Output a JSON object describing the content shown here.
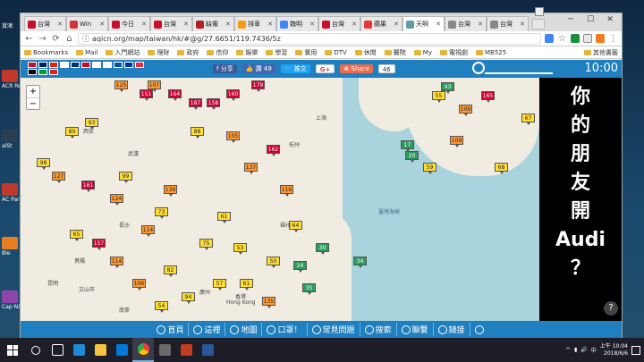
{
  "desktop": {
    "icons": [
      {
        "label": "賞鴻"
      },
      {
        "label": "ACR Read"
      },
      {
        "label": "alSt"
      },
      {
        "label": "AC Parti"
      },
      {
        "label": "Ble"
      },
      {
        "label": "Cap NX"
      }
    ]
  },
  "browser": {
    "tabs": [
      {
        "label": "台灣",
        "icon": "flag-tw-favicon",
        "color": "#c8102e"
      },
      {
        "label": "Win",
        "icon": "red-circle-favicon",
        "color": "#d13438"
      },
      {
        "label": "今日",
        "icon": "flag-favicon",
        "color": "#c8102e"
      },
      {
        "label": "台灣",
        "icon": "flag-favicon",
        "color": "#c8102e"
      },
      {
        "label": "缺電",
        "icon": "news-favicon",
        "color": "#b22222"
      },
      {
        "label": "排車",
        "icon": "orange-favicon",
        "color": "#f39c12"
      },
      {
        "label": "魏明",
        "icon": "google-favicon",
        "color": "#4285f4"
      },
      {
        "label": "台灣",
        "icon": "flag-favicon",
        "color": "#c8102e"
      },
      {
        "label": "蘋果",
        "icon": "apple-favicon",
        "color": "#e53935"
      },
      {
        "label": "天啊",
        "icon": "loading-favicon",
        "color": "#5f9ea0"
      },
      {
        "label": "台灣",
        "icon": "page-favicon",
        "color": "#888888"
      },
      {
        "label": "台灣",
        "icon": "page-favicon",
        "color": "#888888"
      }
    ],
    "url": "aqicn.org/map/taiwan/hk/#@g/27.6651/119.7436/5z",
    "bookmarks": [
      "Bookmarks",
      "Mail",
      "入門網站",
      "理財",
      "政府",
      "信仰",
      "娛樂",
      "學習",
      "實用",
      "DTV",
      "休閒",
      "醫院",
      "My",
      "電視劇",
      "MB525"
    ],
    "bookmarks_other": "其他書籤"
  },
  "site": {
    "share_label": "分享",
    "like_label": "讚",
    "like_count": "49",
    "tweet_label": "推文",
    "gplus_label": "G+",
    "sharebtn_label": "Share",
    "share_count": "46",
    "clock": "10:00",
    "video_text": [
      "你",
      "的",
      "朋",
      "友",
      "開",
      "Audi",
      "？"
    ],
    "help_label": "?",
    "nav": [
      {
        "label": "首頁",
        "icon": "home-icon"
      },
      {
        "label": "這裡",
        "icon": "location-icon"
      },
      {
        "label": "地圖",
        "icon": "map-icon"
      },
      {
        "label": "口罩！",
        "icon": "mask-icon"
      },
      {
        "label": "常見問題",
        "icon": "faq-icon"
      },
      {
        "label": "搜索",
        "icon": "search-icon"
      },
      {
        "label": "聯繫",
        "icon": "contact-icon"
      },
      {
        "label": "鏈接",
        "icon": "link-icon"
      },
      {
        "label": "",
        "icon": "settings-icon"
      }
    ]
  },
  "map": {
    "sea_label": "臺灣海峽",
    "places": [
      "西安",
      "武漢",
      "長沙",
      "杭州",
      "上海",
      "福州",
      "廣州",
      "香港",
      "Hong Kong",
      "貴陽",
      "南寧",
      "文山市",
      "昆明"
    ],
    "markers": [
      {
        "v": "125",
        "c": "o"
      },
      {
        "v": "107",
        "c": "o"
      },
      {
        "v": "151",
        "c": "r"
      },
      {
        "v": "164",
        "c": "r"
      },
      {
        "v": "187",
        "c": "r"
      },
      {
        "v": "158",
        "c": "r"
      },
      {
        "v": "160",
        "c": "r"
      },
      {
        "v": "179",
        "c": "r"
      },
      {
        "v": "89",
        "c": "y"
      },
      {
        "v": "93",
        "c": "y"
      },
      {
        "v": "98",
        "c": "y"
      },
      {
        "v": "127",
        "c": "o"
      },
      {
        "v": "161",
        "c": "r"
      },
      {
        "v": "124",
        "c": "o"
      },
      {
        "v": "99",
        "c": "y"
      },
      {
        "v": "73",
        "c": "y"
      },
      {
        "v": "139",
        "c": "o"
      },
      {
        "v": "114",
        "c": "o"
      },
      {
        "v": "65",
        "c": "y"
      },
      {
        "v": "157",
        "c": "r"
      },
      {
        "v": "75",
        "c": "y"
      },
      {
        "v": "61",
        "c": "y"
      },
      {
        "v": "53",
        "c": "y"
      },
      {
        "v": "30",
        "c": "g"
      },
      {
        "v": "34",
        "c": "g"
      },
      {
        "v": "20",
        "c": "g"
      },
      {
        "v": "55",
        "c": "y"
      },
      {
        "v": "43",
        "c": "g"
      },
      {
        "v": "165",
        "c": "r"
      },
      {
        "v": "67",
        "c": "y"
      },
      {
        "v": "17",
        "c": "g"
      },
      {
        "v": "109",
        "c": "o"
      },
      {
        "v": "59",
        "c": "y"
      },
      {
        "v": "68",
        "c": "y"
      },
      {
        "v": "109",
        "c": "o"
      },
      {
        "v": "162",
        "c": "r"
      },
      {
        "v": "137",
        "c": "o"
      },
      {
        "v": "116",
        "c": "o"
      },
      {
        "v": "64",
        "c": "y"
      },
      {
        "v": "88",
        "c": "y"
      },
      {
        "v": "105",
        "c": "o"
      },
      {
        "v": "50",
        "c": "y"
      },
      {
        "v": "24",
        "c": "g"
      },
      {
        "v": "35",
        "c": "g"
      },
      {
        "v": "114",
        "c": "o"
      },
      {
        "v": "106",
        "c": "o"
      },
      {
        "v": "82",
        "c": "y"
      },
      {
        "v": "94",
        "c": "y"
      },
      {
        "v": "57",
        "c": "y"
      },
      {
        "v": "61",
        "c": "y"
      },
      {
        "v": "54",
        "c": "y"
      },
      {
        "v": "135",
        "c": "o"
      }
    ]
  },
  "taskbar": {
    "time": "上午 10:04",
    "date": "2018/6/6"
  }
}
